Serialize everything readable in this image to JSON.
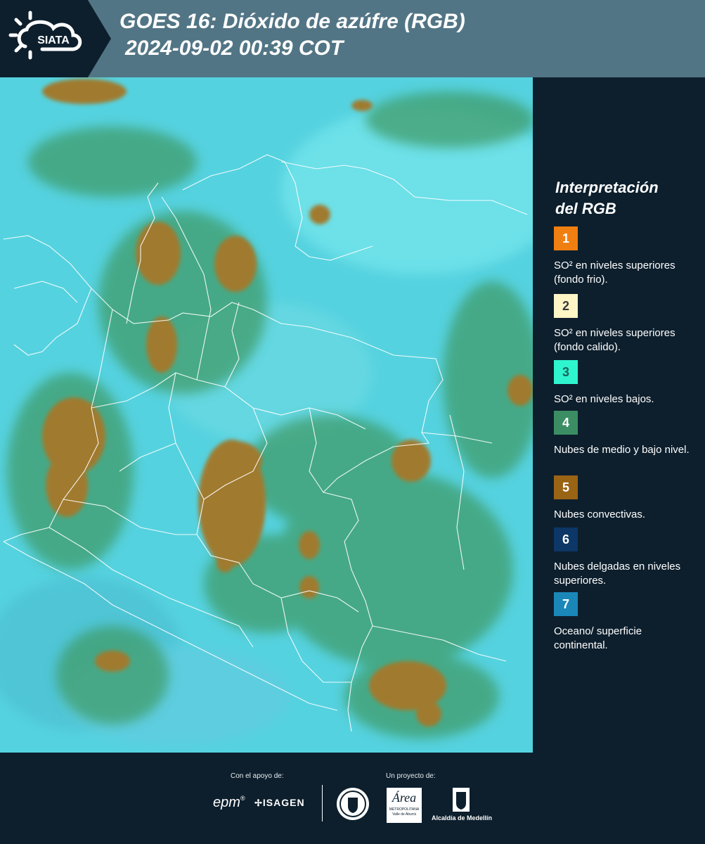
{
  "header": {
    "brand": "SIATA",
    "title_line1": "GOES 16: Dióxido de azúfre (RGB)",
    "title_line2": "2024-09-02 00:39 COT"
  },
  "legend": {
    "title_line1": "Interpretación",
    "title_line2": "del RGB",
    "items": [
      {
        "number": "1",
        "color": "#f07f12",
        "text_color": "#ffffff",
        "label": "SO² en niveles superiores (fondo frio)."
      },
      {
        "number": "2",
        "color": "#fff6c6",
        "text_color": "#3a3a3a",
        "label": "SO² en niveles superiores (fondo calido)."
      },
      {
        "number": "3",
        "color": "#2ff5cf",
        "text_color": "#1d5f58",
        "label": "SO² en niveles bajos."
      },
      {
        "number": "4",
        "color": "#3b8e63",
        "text_color": "#ffffff",
        "label": "Nubes de medio y bajo nivel."
      },
      {
        "number": "5",
        "color": "#9a6415",
        "text_color": "#ffffff",
        "label": "Nubes convectivas."
      },
      {
        "number": "6",
        "color": "#0c3766",
        "text_color": "#ffffff",
        "label": "Nubes delgadas en niveles superiores."
      },
      {
        "number": "7",
        "color": "#1b87b9",
        "text_color": "#ffffff",
        "label": "Oceano/ superficie continental."
      }
    ]
  },
  "footer": {
    "support_caption": "Con el apoyo de:",
    "project_caption": "Un proyecto de:",
    "epm": "epm",
    "isagen": "ISAGEN",
    "area": "Área",
    "area_sub1": "METROPOLITANA",
    "area_sub2": "Valle de Aburrá",
    "alcaldia": "Alcaldía de Medellín"
  }
}
